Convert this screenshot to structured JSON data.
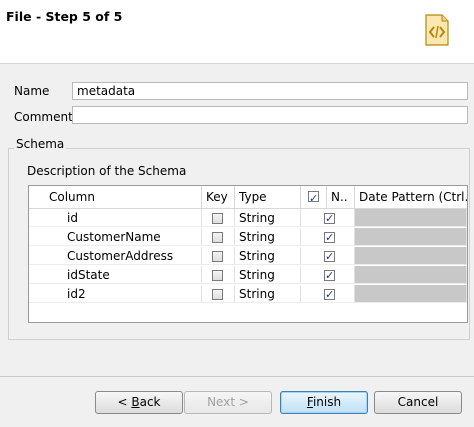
{
  "window": {
    "title": "File - Step 5 of 5"
  },
  "form": {
    "name_label": "Name",
    "name_value": "metadata",
    "comment_label": "Comment",
    "comment_value": ""
  },
  "schema": {
    "group_label": "Schema",
    "description_label": "Description of the Schema",
    "columns": {
      "column": "Column",
      "key": "Key",
      "type": "Type",
      "nullable": "N..",
      "date_pattern": "Date Pattern (Ctrl..."
    },
    "header_nullable_checked": true,
    "rows": [
      {
        "column": "id",
        "key": false,
        "type": "String",
        "nullable": true
      },
      {
        "column": "CustomerName",
        "key": false,
        "type": "String",
        "nullable": true
      },
      {
        "column": "CustomerAddress",
        "key": false,
        "type": "String",
        "nullable": true
      },
      {
        "column": "idState",
        "key": false,
        "type": "String",
        "nullable": true
      },
      {
        "column": "id2",
        "key": false,
        "type": "String",
        "nullable": true
      }
    ]
  },
  "buttons": {
    "back": {
      "prefix": "< ",
      "mnemonic": "B",
      "rest": "ack"
    },
    "next": "Next >",
    "finish": {
      "mnemonic": "F",
      "rest": "inish"
    },
    "cancel": "Cancel"
  }
}
